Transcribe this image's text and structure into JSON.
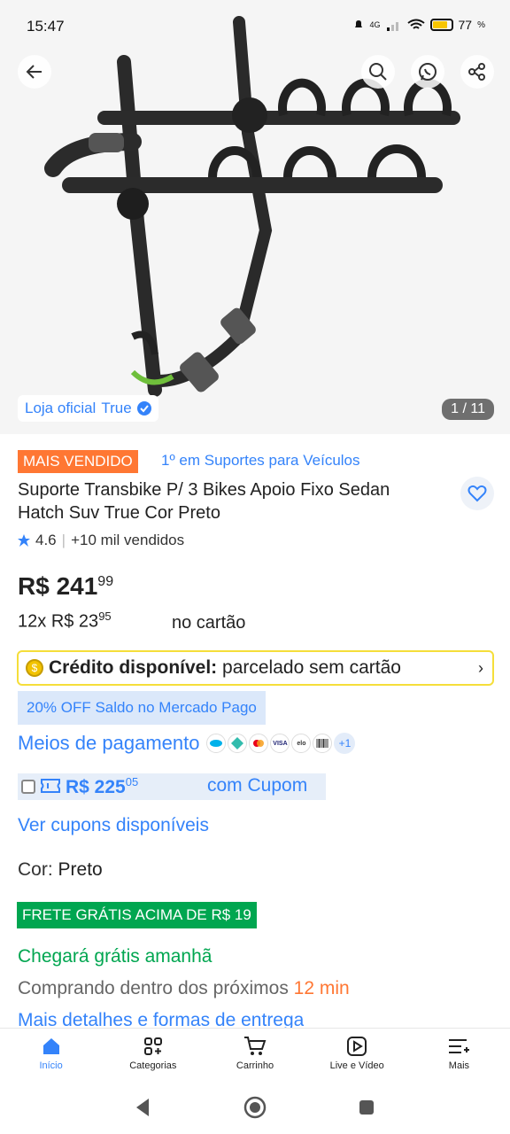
{
  "status_bar": {
    "time": "15:47",
    "network": "4G",
    "battery": "77"
  },
  "gallery": {
    "store_prefix": "Loja oficial",
    "store_name": "True",
    "counter": "1 / 11"
  },
  "product": {
    "badge": "MAIS VENDIDO",
    "category_rank": "1º em Suportes para Veículos",
    "title": "Suporte Transbike P/ 3 Bikes Apoio Fixo Sedan Hatch Suv True Cor Preto",
    "rating": "4.6",
    "sold": "+10 mil vendidos",
    "price_int": "R$ 241",
    "price_cents": "99",
    "installments_count": "12x",
    "installment_int": "R$ 23",
    "installment_cents": "95",
    "installment_suffix": "no cartão"
  },
  "credit": {
    "label": "Crédito disponível:",
    "text": "parcelado sem cartão",
    "chevron": "›"
  },
  "discount": "20% OFF Saldo no Mercado Pago",
  "payments": {
    "label": "Meios de pagamento",
    "icons": [
      "mercado-pago-icon",
      "pix-icon",
      "mastercard-icon",
      "visa-icon",
      "elo-icon",
      "boleto-icon"
    ],
    "more": "+1"
  },
  "coupon": {
    "price_int": "R$ 225",
    "price_cents": "05",
    "text": "com Cupom"
  },
  "see_coupons": "Ver cupons disponíveis",
  "color": {
    "label": "Cor:",
    "value": "Preto"
  },
  "shipping": {
    "badge": "FRETE GRÁTIS ACIMA DE R$ 19",
    "arrival": "Chegará grátis amanhã",
    "buying_prefix": "Comprando dentro dos próximos",
    "buying_time": "12 min",
    "more": "Mais detalhes e formas de entrega"
  },
  "bottom_nav": [
    {
      "label": "Início",
      "icon": "home-icon",
      "active": true
    },
    {
      "label": "Categorias",
      "icon": "categories-icon",
      "active": false
    },
    {
      "label": "Carrinho",
      "icon": "cart-icon",
      "active": false
    },
    {
      "label": "Live e Vídeo",
      "icon": "play-icon",
      "active": false
    },
    {
      "label": "Mais",
      "icon": "menu-icon",
      "active": false
    }
  ],
  "colors": {
    "brand_blue": "#3483fa",
    "green": "#00a650",
    "orange": "#ff7733",
    "yellow": "#f5de3a"
  }
}
